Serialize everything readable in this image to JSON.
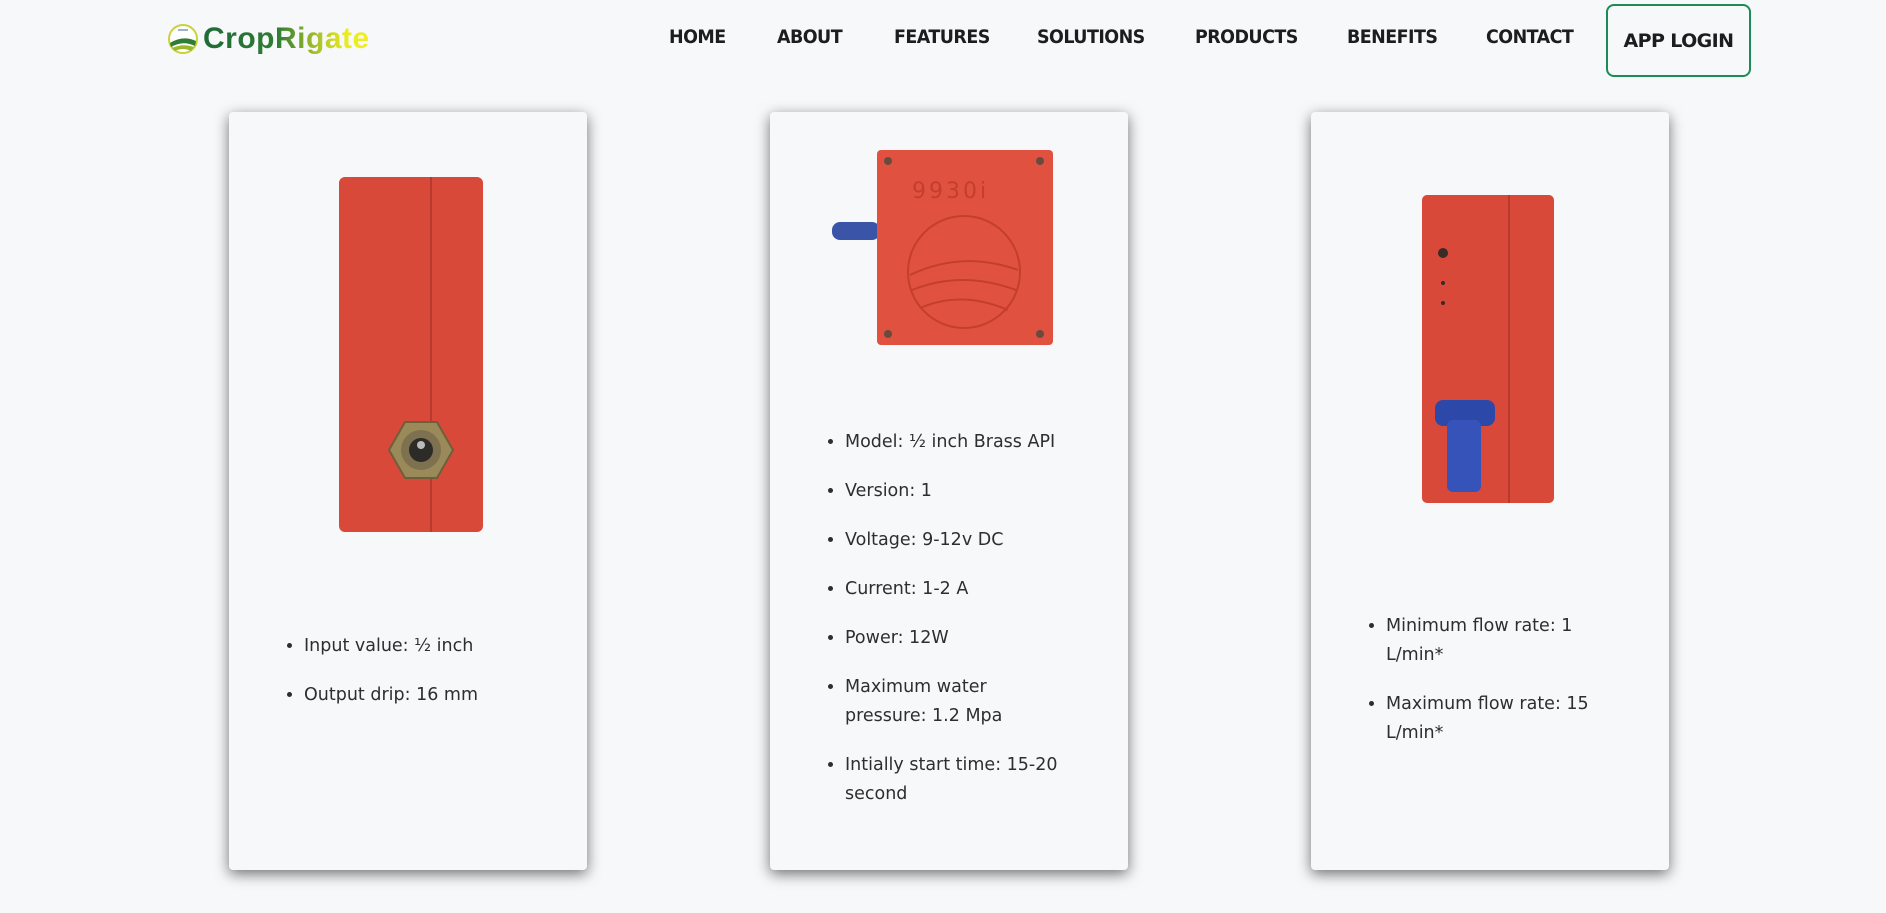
{
  "brand": {
    "name": "CropRigate"
  },
  "nav": {
    "items": [
      "HOME",
      "ABOUT",
      "FEATURES",
      "SOLUTIONS",
      "PRODUCTS",
      "BENEFITS",
      "CONTACT"
    ],
    "login": "APP LOGIN"
  },
  "products": [
    {
      "specs": [
        "Input value: ½ inch",
        "Output drip: 16 mm"
      ]
    },
    {
      "device_label": "9930i",
      "specs": [
        "Model: ½ inch Brass API",
        "Version: 1",
        "Voltage: 9-12v DC",
        "Current: 1-2 A",
        "Power: 12W",
        "Maximum water pressure: 1.2 Mpa",
        "Intially start time: 15-20 second"
      ]
    },
    {
      "specs": [
        "Minimum flow rate: 1 L/min*",
        "Maximum flow rate: 15 L/min*"
      ]
    }
  ],
  "colors": {
    "accent": "#1e8a55",
    "device": "#e0523f"
  }
}
